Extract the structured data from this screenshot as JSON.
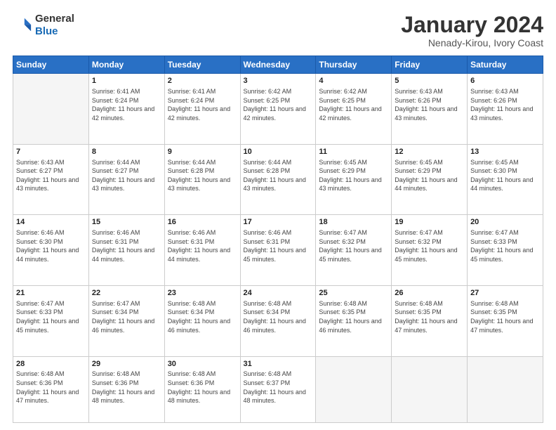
{
  "logo": {
    "line1": "General",
    "line2": "Blue"
  },
  "title": "January 2024",
  "subtitle": "Nenady-Kirou, Ivory Coast",
  "days_of_week": [
    "Sunday",
    "Monday",
    "Tuesday",
    "Wednesday",
    "Thursday",
    "Friday",
    "Saturday"
  ],
  "weeks": [
    [
      {
        "num": "",
        "empty": true
      },
      {
        "num": "1",
        "sunrise": "6:41 AM",
        "sunset": "6:24 PM",
        "daylight": "11 hours and 42 minutes."
      },
      {
        "num": "2",
        "sunrise": "6:41 AM",
        "sunset": "6:24 PM",
        "daylight": "11 hours and 42 minutes."
      },
      {
        "num": "3",
        "sunrise": "6:42 AM",
        "sunset": "6:25 PM",
        "daylight": "11 hours and 42 minutes."
      },
      {
        "num": "4",
        "sunrise": "6:42 AM",
        "sunset": "6:25 PM",
        "daylight": "11 hours and 42 minutes."
      },
      {
        "num": "5",
        "sunrise": "6:43 AM",
        "sunset": "6:26 PM",
        "daylight": "11 hours and 43 minutes."
      },
      {
        "num": "6",
        "sunrise": "6:43 AM",
        "sunset": "6:26 PM",
        "daylight": "11 hours and 43 minutes."
      }
    ],
    [
      {
        "num": "7",
        "sunrise": "6:43 AM",
        "sunset": "6:27 PM",
        "daylight": "11 hours and 43 minutes."
      },
      {
        "num": "8",
        "sunrise": "6:44 AM",
        "sunset": "6:27 PM",
        "daylight": "11 hours and 43 minutes."
      },
      {
        "num": "9",
        "sunrise": "6:44 AM",
        "sunset": "6:28 PM",
        "daylight": "11 hours and 43 minutes."
      },
      {
        "num": "10",
        "sunrise": "6:44 AM",
        "sunset": "6:28 PM",
        "daylight": "11 hours and 43 minutes."
      },
      {
        "num": "11",
        "sunrise": "6:45 AM",
        "sunset": "6:29 PM",
        "daylight": "11 hours and 43 minutes."
      },
      {
        "num": "12",
        "sunrise": "6:45 AM",
        "sunset": "6:29 PM",
        "daylight": "11 hours and 44 minutes."
      },
      {
        "num": "13",
        "sunrise": "6:45 AM",
        "sunset": "6:30 PM",
        "daylight": "11 hours and 44 minutes."
      }
    ],
    [
      {
        "num": "14",
        "sunrise": "6:46 AM",
        "sunset": "6:30 PM",
        "daylight": "11 hours and 44 minutes."
      },
      {
        "num": "15",
        "sunrise": "6:46 AM",
        "sunset": "6:31 PM",
        "daylight": "11 hours and 44 minutes."
      },
      {
        "num": "16",
        "sunrise": "6:46 AM",
        "sunset": "6:31 PM",
        "daylight": "11 hours and 44 minutes."
      },
      {
        "num": "17",
        "sunrise": "6:46 AM",
        "sunset": "6:31 PM",
        "daylight": "11 hours and 45 minutes."
      },
      {
        "num": "18",
        "sunrise": "6:47 AM",
        "sunset": "6:32 PM",
        "daylight": "11 hours and 45 minutes."
      },
      {
        "num": "19",
        "sunrise": "6:47 AM",
        "sunset": "6:32 PM",
        "daylight": "11 hours and 45 minutes."
      },
      {
        "num": "20",
        "sunrise": "6:47 AM",
        "sunset": "6:33 PM",
        "daylight": "11 hours and 45 minutes."
      }
    ],
    [
      {
        "num": "21",
        "sunrise": "6:47 AM",
        "sunset": "6:33 PM",
        "daylight": "11 hours and 45 minutes."
      },
      {
        "num": "22",
        "sunrise": "6:47 AM",
        "sunset": "6:34 PM",
        "daylight": "11 hours and 46 minutes."
      },
      {
        "num": "23",
        "sunrise": "6:48 AM",
        "sunset": "6:34 PM",
        "daylight": "11 hours and 46 minutes."
      },
      {
        "num": "24",
        "sunrise": "6:48 AM",
        "sunset": "6:34 PM",
        "daylight": "11 hours and 46 minutes."
      },
      {
        "num": "25",
        "sunrise": "6:48 AM",
        "sunset": "6:35 PM",
        "daylight": "11 hours and 46 minutes."
      },
      {
        "num": "26",
        "sunrise": "6:48 AM",
        "sunset": "6:35 PM",
        "daylight": "11 hours and 47 minutes."
      },
      {
        "num": "27",
        "sunrise": "6:48 AM",
        "sunset": "6:35 PM",
        "daylight": "11 hours and 47 minutes."
      }
    ],
    [
      {
        "num": "28",
        "sunrise": "6:48 AM",
        "sunset": "6:36 PM",
        "daylight": "11 hours and 47 minutes."
      },
      {
        "num": "29",
        "sunrise": "6:48 AM",
        "sunset": "6:36 PM",
        "daylight": "11 hours and 48 minutes."
      },
      {
        "num": "30",
        "sunrise": "6:48 AM",
        "sunset": "6:36 PM",
        "daylight": "11 hours and 48 minutes."
      },
      {
        "num": "31",
        "sunrise": "6:48 AM",
        "sunset": "6:37 PM",
        "daylight": "11 hours and 48 minutes."
      },
      {
        "num": "",
        "empty": true
      },
      {
        "num": "",
        "empty": true
      },
      {
        "num": "",
        "empty": true
      }
    ]
  ]
}
